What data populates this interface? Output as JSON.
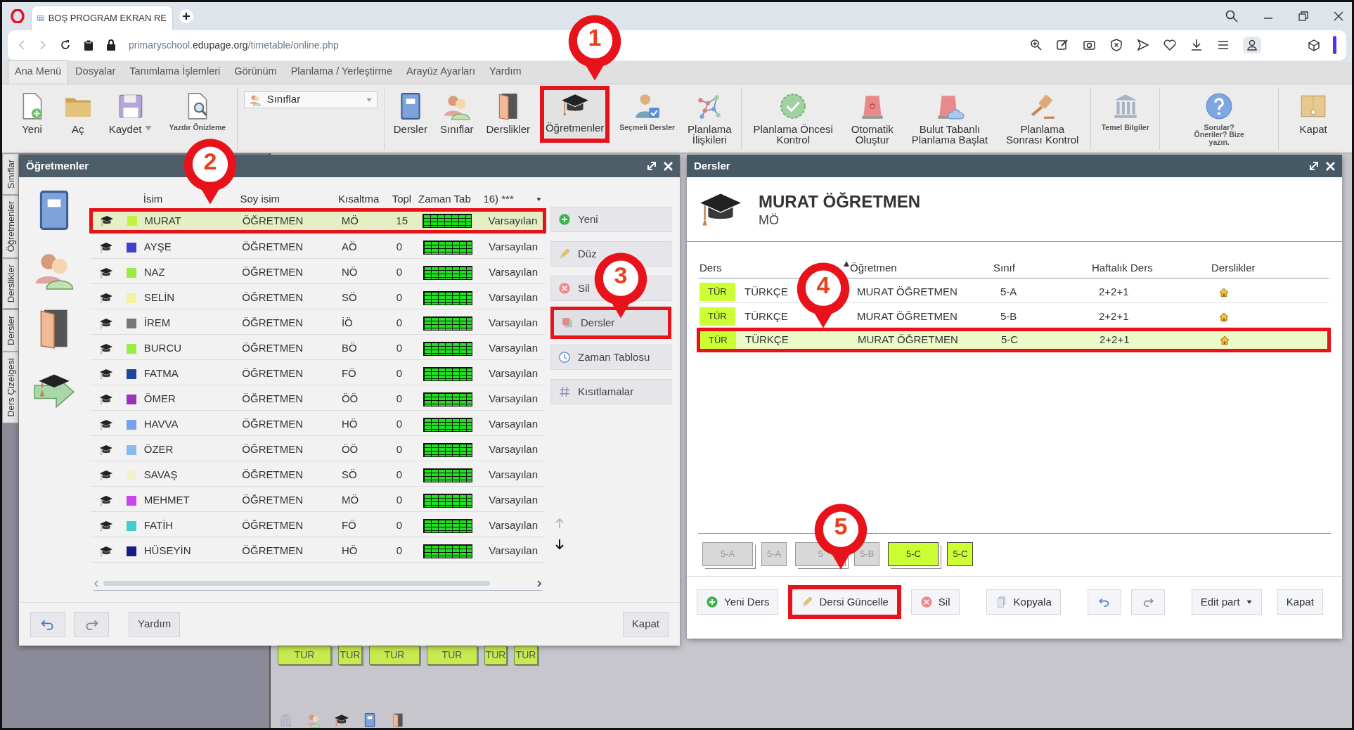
{
  "browser": {
    "tab_title": "BOŞ PROGRAM EKRAN RE",
    "url": {
      "subdomain": "primaryschool.",
      "domain": "edupage.org",
      "path": "/timetable/online.php"
    }
  },
  "menu_tabs": [
    {
      "label": "Ana Menü",
      "selected": true
    },
    {
      "label": "Dosyalar",
      "selected": false
    },
    {
      "label": "Tanımlama İşlemleri",
      "selected": false
    },
    {
      "label": "Görünüm",
      "selected": false
    },
    {
      "label": "Planlama / Yerleştirme",
      "selected": false
    },
    {
      "label": "Arayüz Ayarları",
      "selected": false
    },
    {
      "label": "Yardım",
      "selected": false
    }
  ],
  "toolbar": {
    "groups": [
      {
        "items": [
          {
            "kind": "button",
            "lines": [
              "Yeni"
            ],
            "highlighted": false
          },
          {
            "kind": "button",
            "lines": [
              "Aç"
            ],
            "highlighted": false
          },
          {
            "kind": "split_button",
            "lines": [
              "Kaydet"
            ],
            "highlighted": false
          },
          {
            "kind": "small_button",
            "lines": [
              "Yazdır Önizleme"
            ],
            "highlighted": false
          }
        ]
      },
      {
        "items": [
          {
            "kind": "dropdown",
            "value": "Sınıflar"
          }
        ]
      },
      {
        "items": [
          {
            "kind": "button",
            "lines": [
              "Dersler"
            ],
            "highlighted": false
          },
          {
            "kind": "button",
            "lines": [
              "Sınıflar"
            ],
            "highlighted": false
          },
          {
            "kind": "button",
            "lines": [
              "Derslikler"
            ],
            "highlighted": false
          },
          {
            "kind": "button",
            "lines": [
              "Öğretmenler"
            ],
            "highlighted": true
          },
          {
            "kind": "small_button",
            "lines": [
              "Seçmeli Dersler"
            ],
            "highlighted": false
          },
          {
            "kind": "button",
            "lines": [
              "Planlama",
              "İlişkileri"
            ],
            "highlighted": false
          }
        ]
      },
      {
        "items": [
          {
            "kind": "button",
            "lines": [
              "Planlama Öncesi",
              "Kontrol"
            ],
            "highlighted": false
          },
          {
            "kind": "button",
            "lines": [
              "Otomatik",
              "Oluştur"
            ],
            "highlighted": false
          },
          {
            "kind": "button",
            "lines": [
              "Bulut Tabanlı",
              "Planlama Başlat"
            ],
            "highlighted": false
          },
          {
            "kind": "button",
            "lines": [
              "Planlama",
              "Sonrası Kontrol"
            ],
            "highlighted": false
          }
        ]
      },
      {
        "items": [
          {
            "kind": "small_button",
            "lines": [
              "Temel Bilgiler"
            ],
            "highlighted": false
          }
        ]
      },
      {
        "items": [
          {
            "kind": "small_button",
            "lines": [
              "Sorular?",
              "Öneriler? Bize",
              "yazın."
            ],
            "highlighted": false
          }
        ]
      },
      {
        "items": [
          {
            "kind": "button",
            "lines": [
              "Kapat"
            ],
            "highlighted": false
          }
        ]
      }
    ]
  },
  "side_tabs": [
    "Sınıflar",
    "Öğretmenler",
    "Derslikler",
    "Dersler",
    "Ders Çizelgesi"
  ],
  "teachers_dialog": {
    "title": "Öğretmenler",
    "columns": [
      "İsim",
      "Soy isim",
      "Kısaltma",
      "Topl",
      "Zaman Tab",
      "16) ***"
    ],
    "rows": [
      {
        "name": "MURAT",
        "surname": "ÖĞRETMEN",
        "abbr": "MÖ",
        "total": "15",
        "timetable": "Varsayılan",
        "color": "#c6f040",
        "selected": true,
        "highlighted": true
      },
      {
        "name": "AYŞE",
        "surname": "ÖĞRETMEN",
        "abbr": "AÖ",
        "total": "0",
        "timetable": "Varsayılan",
        "color": "#4040cc",
        "selected": false,
        "highlighted": false
      },
      {
        "name": "NAZ",
        "surname": "ÖĞRETMEN",
        "abbr": "NÖ",
        "total": "0",
        "timetable": "Varsayılan",
        "color": "#99ee44",
        "selected": false,
        "highlighted": false
      },
      {
        "name": "SELİN",
        "surname": "ÖĞRETMEN",
        "abbr": "SÖ",
        "total": "0",
        "timetable": "Varsayılan",
        "color": "#f2f2a0",
        "selected": false,
        "highlighted": false
      },
      {
        "name": "İREM",
        "surname": "ÖĞRETMEN",
        "abbr": "İÖ",
        "total": "0",
        "timetable": "Varsayılan",
        "color": "#777777",
        "selected": false,
        "highlighted": false
      },
      {
        "name": "BURCU",
        "surname": "ÖĞRETMEN",
        "abbr": "BÖ",
        "total": "0",
        "timetable": "Varsayılan",
        "color": "#99ee44",
        "selected": false,
        "highlighted": false
      },
      {
        "name": "FATMA",
        "surname": "ÖĞRETMEN",
        "abbr": "FÖ",
        "total": "0",
        "timetable": "Varsayılan",
        "color": "#1f449c",
        "selected": false,
        "highlighted": false
      },
      {
        "name": "ÖMER",
        "surname": "ÖĞRETMEN",
        "abbr": "ÖÖ",
        "total": "0",
        "timetable": "Varsayılan",
        "color": "#9933bb",
        "selected": false,
        "highlighted": false
      },
      {
        "name": "HAVVA",
        "surname": "ÖĞRETMEN",
        "abbr": "HÖ",
        "total": "0",
        "timetable": "Varsayılan",
        "color": "#77a0ee",
        "selected": false,
        "highlighted": false
      },
      {
        "name": "ÖZER",
        "surname": "ÖĞRETMEN",
        "abbr": "ÖÖ",
        "total": "0",
        "timetable": "Varsayılan",
        "color": "#88bbee",
        "selected": false,
        "highlighted": false
      },
      {
        "name": "SAVAŞ",
        "surname": "ÖĞRETMEN",
        "abbr": "SÖ",
        "total": "0",
        "timetable": "Varsayılan",
        "color": "#f2f2c8",
        "selected": false,
        "highlighted": false
      },
      {
        "name": "MEHMET",
        "surname": "ÖĞRETMEN",
        "abbr": "MÖ",
        "total": "0",
        "timetable": "Varsayılan",
        "color": "#cc44ee",
        "selected": false,
        "highlighted": false
      },
      {
        "name": "FATİH",
        "surname": "ÖĞRETMEN",
        "abbr": "FÖ",
        "total": "0",
        "timetable": "Varsayılan",
        "color": "#44cccc",
        "selected": false,
        "highlighted": false
      },
      {
        "name": "HÜSEYİN",
        "surname": "ÖĞRETMEN",
        "abbr": "HÖ",
        "total": "0",
        "timetable": "Varsayılan",
        "color": "#1a1a88",
        "selected": false,
        "highlighted": false
      }
    ],
    "side_buttons": [
      {
        "label": "Yeni",
        "highlighted": false
      },
      {
        "label": "Düz",
        "highlighted": false
      },
      {
        "label": "Sil",
        "highlighted": false
      },
      {
        "label": "Dersler",
        "highlighted": true
      },
      {
        "label": "Zaman Tablosu",
        "highlighted": false
      },
      {
        "label": "Kısıtlamalar",
        "highlighted": false
      }
    ],
    "help_button": "Yardım",
    "close_button": "Kapat"
  },
  "lessons_dialog": {
    "title": "Dersler",
    "teacher_name": "MURAT ÖĞRETMEN",
    "teacher_abbr": "MÖ",
    "columns": [
      "Ders",
      "Öğretmen",
      "Sınıf",
      "Haftalık Ders",
      "Derslikler"
    ],
    "rows": [
      {
        "subject_code": "TÜR",
        "subject": "TÜRKÇE",
        "teacher": "MURAT ÖĞRETMEN",
        "class": "5-A",
        "weekly": "2+2+1",
        "color": "#ccff33",
        "selected": false,
        "highlighted": false
      },
      {
        "subject_code": "TÜR",
        "subject": "TÜRKÇE",
        "teacher": "MURAT ÖĞRETMEN",
        "class": "5-B",
        "weekly": "2+2+1",
        "color": "#ccff33",
        "selected": false,
        "highlighted": false
      },
      {
        "subject_code": "TÜR",
        "subject": "TÜRKÇE",
        "teacher": "MURAT ÖĞRETMEN",
        "class": "5-C",
        "weekly": "2+2+1",
        "color": "#ccff33",
        "selected": true,
        "highlighted": true
      }
    ],
    "cards": [
      {
        "label": "5-A",
        "kind": "stacked",
        "active": false
      },
      {
        "label": "5-A",
        "kind": "single",
        "active": false
      },
      {
        "label": "5",
        "kind": "stacked",
        "active": false
      },
      {
        "label": "5-B",
        "kind": "single",
        "active": false
      },
      {
        "label": "5-C",
        "kind": "stacked",
        "active": true
      },
      {
        "label": "5-C",
        "kind": "single",
        "active": true
      }
    ],
    "buttons": [
      {
        "kind": "new",
        "label": "Yeni Ders",
        "highlighted": false
      },
      {
        "kind": "edit",
        "label": "Dersi Güncelle",
        "highlighted": true
      },
      {
        "kind": "delete",
        "label": "Sil",
        "highlighted": false
      },
      {
        "kind": "copy",
        "label": "Kopyala",
        "highlighted": false
      },
      {
        "kind": "undo",
        "highlighted": false
      },
      {
        "kind": "redo",
        "highlighted": false
      },
      {
        "kind": "menu",
        "label": "Edit part",
        "highlighted": false
      },
      {
        "kind": "close",
        "label": "Kapat",
        "highlighted": false
      }
    ]
  },
  "timetable_tiles": [
    "TUR",
    "TUR",
    "TUR",
    "TUR",
    "TUR",
    "TUR"
  ],
  "annotations": [
    {
      "number": "1"
    },
    {
      "number": "2"
    },
    {
      "number": "3"
    },
    {
      "number": "4"
    },
    {
      "number": "5"
    }
  ]
}
